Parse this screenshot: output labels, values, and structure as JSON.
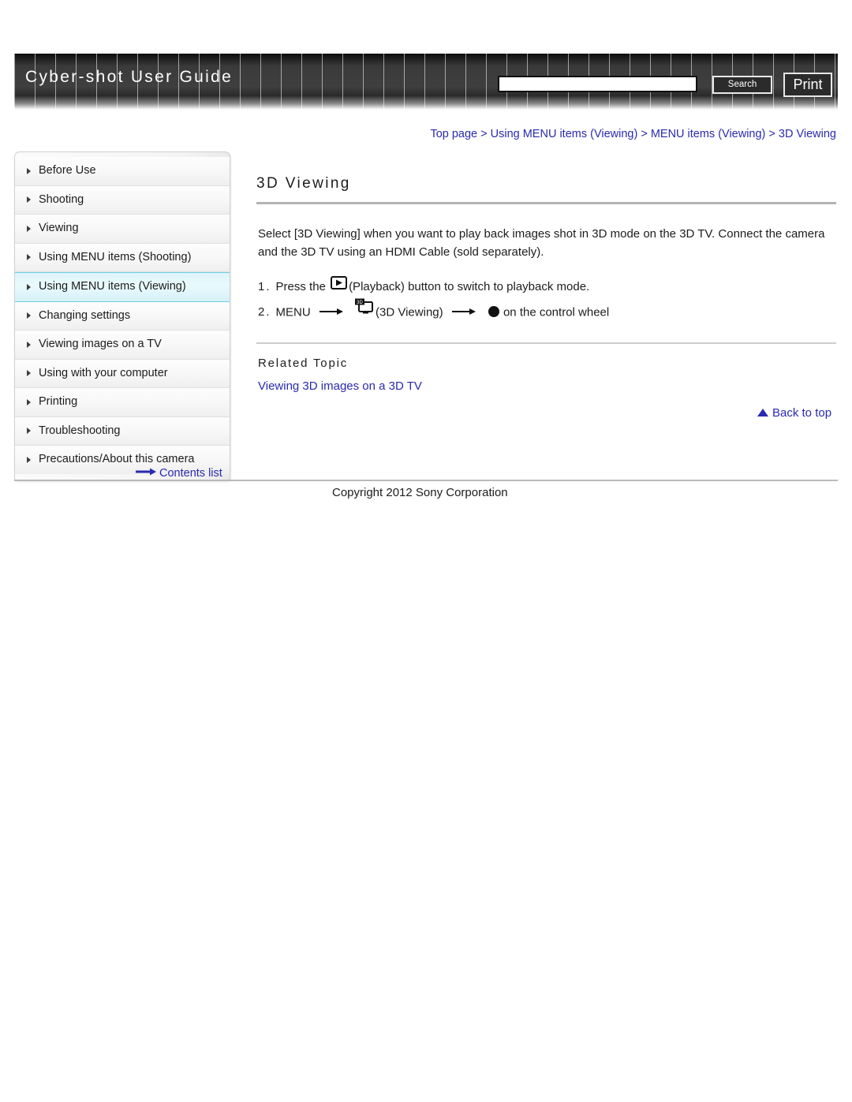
{
  "header": {
    "site_title": "Cyber-shot User Guide",
    "search_value": "",
    "search_placeholder": "",
    "search_button_label": "Search",
    "print_button_label": "Print"
  },
  "breadcrumb": {
    "text": "Top page > Using MENU items (Viewing) > MENU items (Viewing) > 3D Viewing"
  },
  "sidebar": {
    "items": [
      {
        "label": "Before Use",
        "active": false
      },
      {
        "label": "Shooting",
        "active": false
      },
      {
        "label": "Viewing",
        "active": false
      },
      {
        "label": "Using MENU items (Shooting)",
        "active": false
      },
      {
        "label": "Using MENU items (Viewing)",
        "active": true
      },
      {
        "label": "Changing settings",
        "active": false
      },
      {
        "label": "Viewing images on a TV",
        "active": false
      },
      {
        "label": "Using with your computer",
        "active": false
      },
      {
        "label": "Printing",
        "active": false
      },
      {
        "label": "Troubleshooting",
        "active": false
      },
      {
        "label": "Precautions/About this camera",
        "active": false
      }
    ],
    "contents_list_label": "Contents list"
  },
  "content": {
    "title": "3D Viewing",
    "intro": "Select [3D Viewing] when you want to play back images shot in 3D mode on the 3D TV. Connect the camera and the 3D TV using an HDMI Cable (sold separately).",
    "steps": [
      {
        "number": "1.",
        "text_before_icon": "Press the",
        "icon": "playback-button-icon",
        "text_after_icon": "(Playback) button to switch to playback mode."
      },
      {
        "number": "2.",
        "label_menu": "MENU",
        "icon": "3d-tv-icon",
        "label_mode": "(3D Viewing)",
        "dot_icon": "center-button-icon",
        "label_tail": "on the control wheel"
      }
    ],
    "related_heading": "Related Topic",
    "related_link": "Viewing 3D images on a 3D TV",
    "back_to_top": "Back to top"
  },
  "footer": {
    "copyright": "Copyright 2012 Sony Corporation"
  },
  "colors": {
    "link": "#2a2ab0",
    "banner_dark": "#3a3a3a",
    "active_nav": "#ddf4fb",
    "rule": "#b4b4b4"
  }
}
